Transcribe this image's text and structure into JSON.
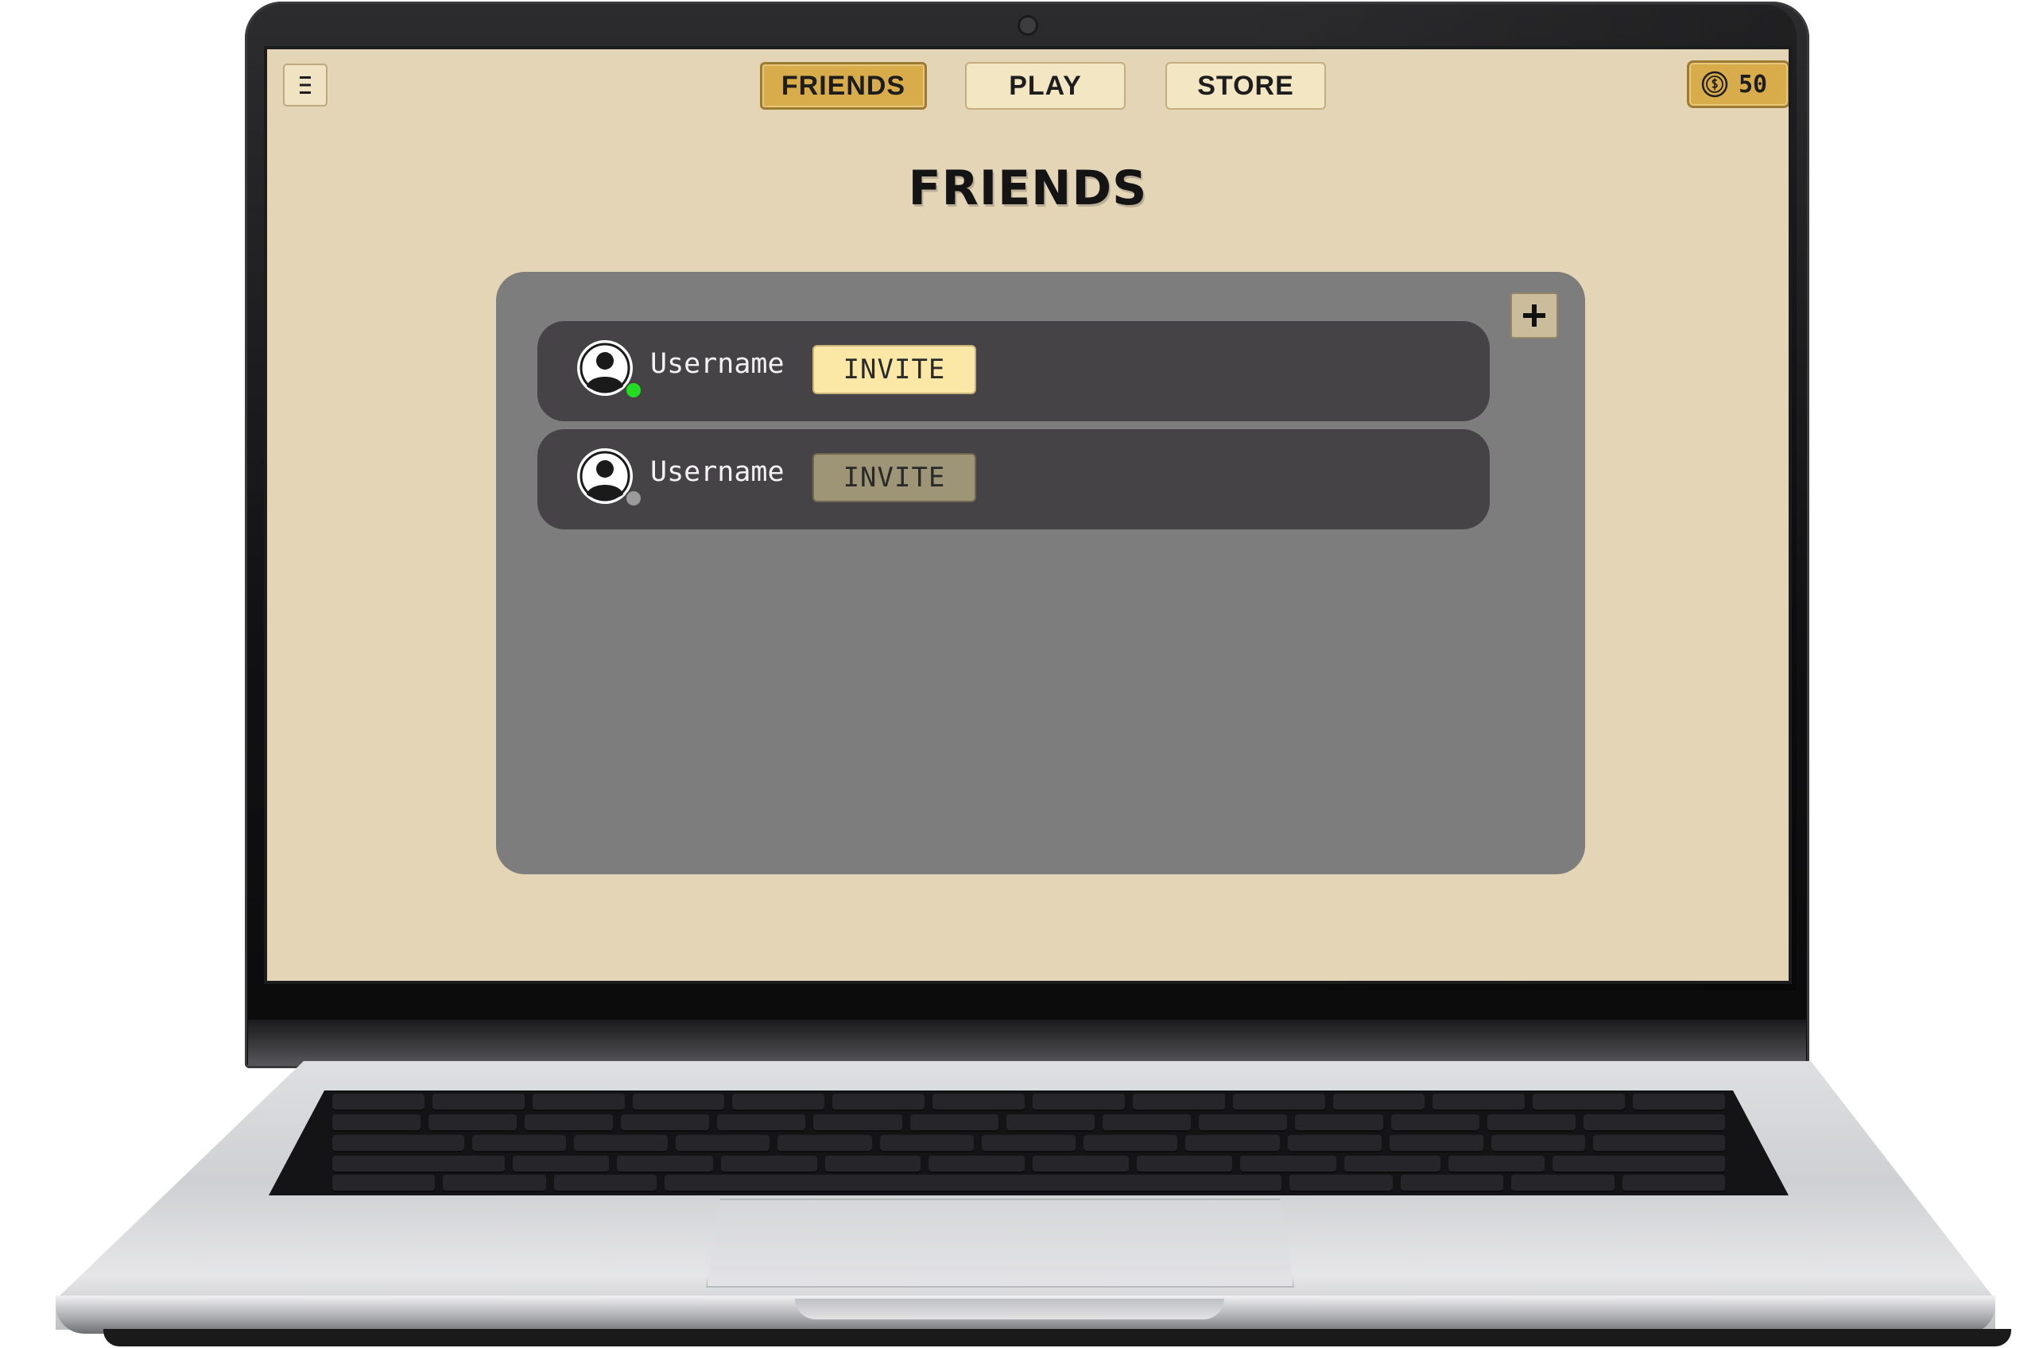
{
  "nav": {
    "menu_icon": "hamburger-icon",
    "tabs": [
      {
        "label": "FRIENDS",
        "active": true
      },
      {
        "label": "PLAY",
        "active": false
      },
      {
        "label": "STORE",
        "active": false
      }
    ]
  },
  "wallet": {
    "icon": "coin-icon",
    "balance": "50"
  },
  "page": {
    "title": "FRIENDS"
  },
  "friends_panel": {
    "add_icon": "plus-icon",
    "friends": [
      {
        "username": "Username",
        "status": "online",
        "invite_label": "INVITE",
        "invite_enabled": true
      },
      {
        "username": "Username",
        "status": "offline",
        "invite_label": "INVITE",
        "invite_enabled": false
      }
    ]
  },
  "colors": {
    "screen_background": "#e4d5b7",
    "accent_gold": "#d9ac4b",
    "panel": "#7d7d7d",
    "row": "#454345",
    "online": "#22dd22",
    "offline": "#9a9a9a",
    "invite_enabled": "#fbe8a6",
    "invite_disabled": "#9e9476"
  }
}
